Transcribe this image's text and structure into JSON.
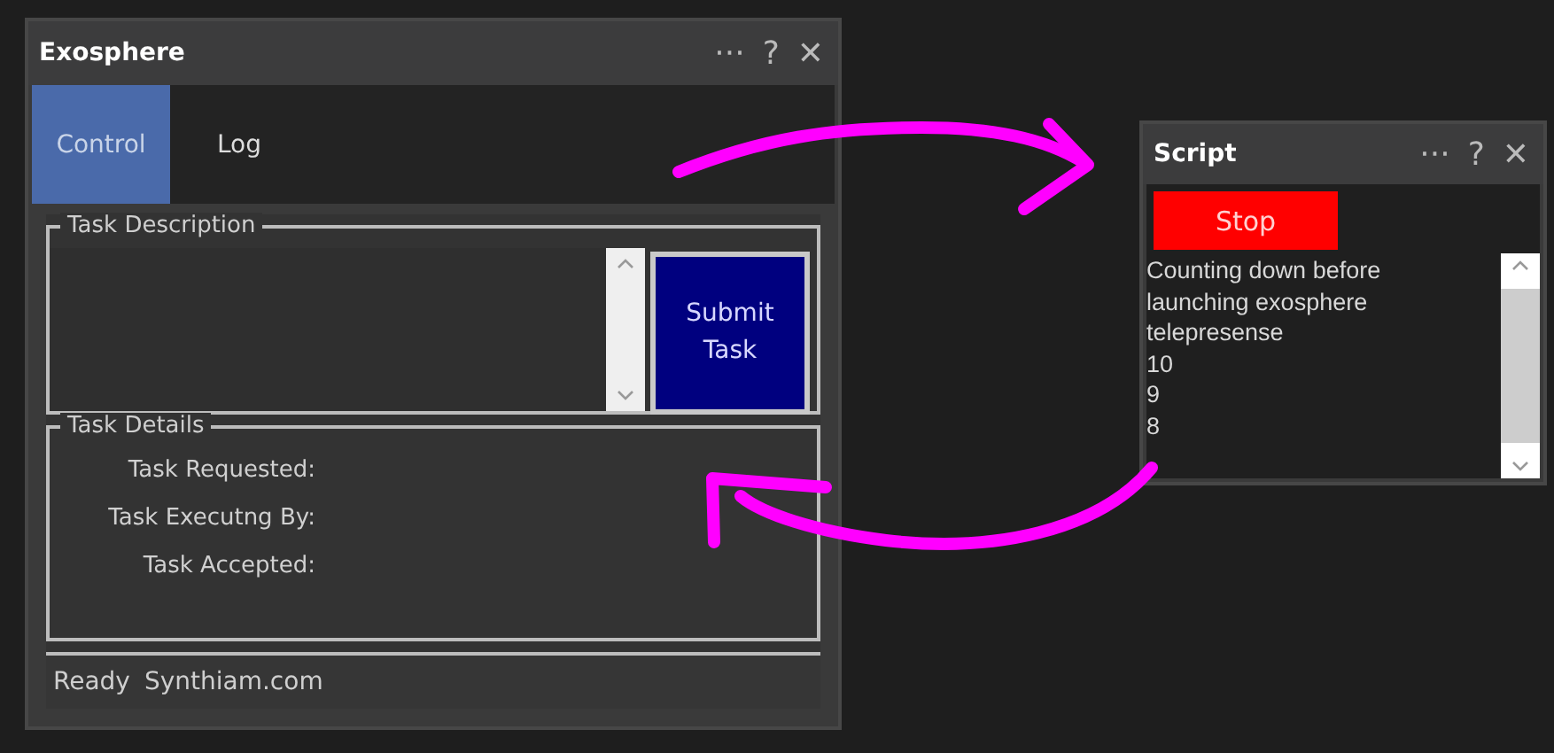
{
  "windows": [
    {
      "title": "Exosphere",
      "title_buttons": [
        "···",
        "?",
        "✕"
      ],
      "tabs": [
        {
          "label": "Control",
          "selected": true
        },
        {
          "label": "Log",
          "selected": false
        }
      ],
      "task_description": {
        "legend": "Task Description",
        "button": "Submit Task"
      },
      "task_details": {
        "legend": "Task Details",
        "fields": [
          "Task Requested:",
          "Task Executng By:",
          "Task Accepted:"
        ]
      },
      "status_bar": [
        "Ready",
        "Synthiam.com"
      ]
    },
    {
      "title": "Script",
      "title_buttons": [
        "···",
        "?",
        "✕"
      ],
      "button": "Stop",
      "output": [
        "Counting down before",
        "launching exosphere",
        "telepresense",
        "10",
        "9",
        "8"
      ]
    }
  ]
}
